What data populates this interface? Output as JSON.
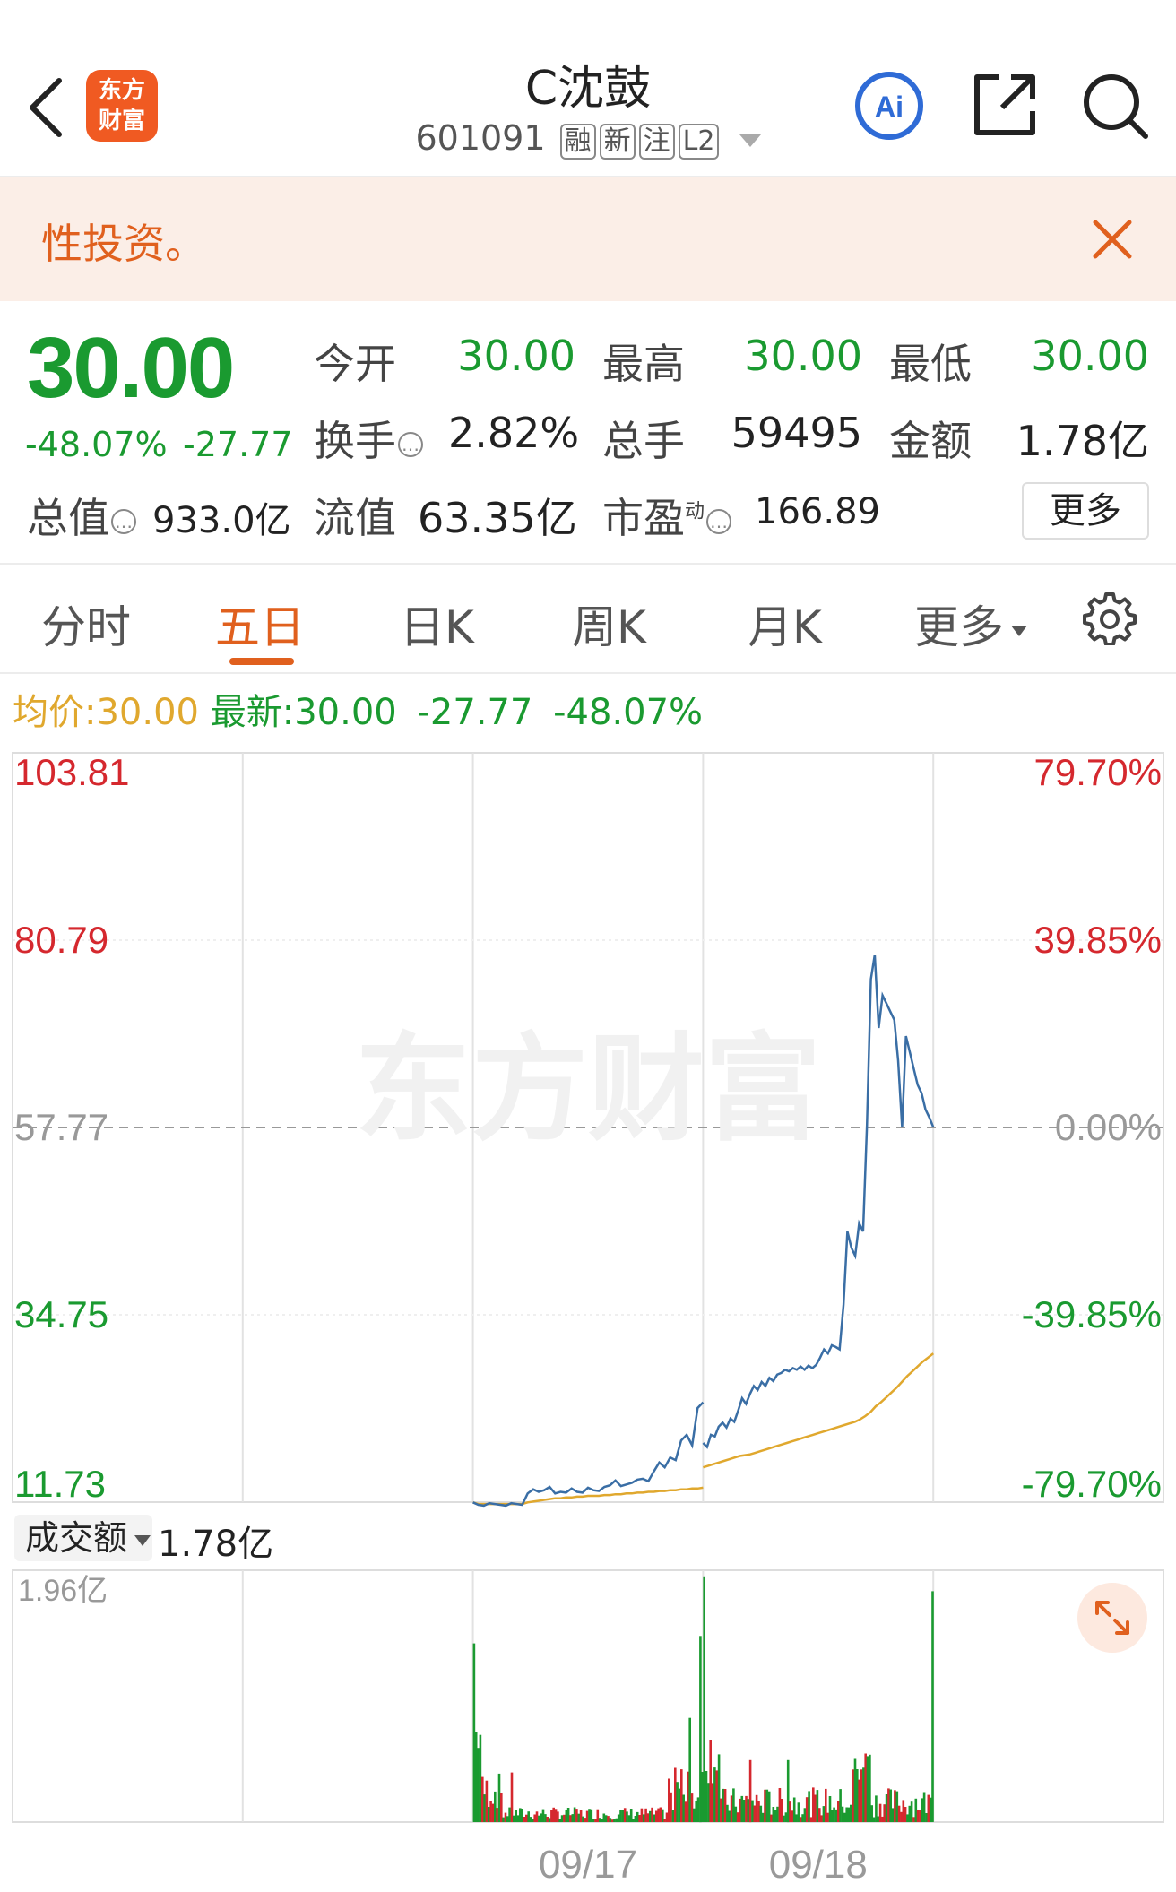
{
  "header": {
    "back_icon": "chevron-left-icon",
    "logo_line1": "东方",
    "logo_line2": "财富",
    "title": "C沈鼓",
    "code": "601091",
    "tags": [
      "融",
      "新",
      "注",
      "L2"
    ],
    "icons": [
      "ai-icon",
      "share-icon",
      "search-icon"
    ],
    "ai_label": "Ai"
  },
  "banner": {
    "text": "性投资。",
    "close_icon": "close-icon"
  },
  "quote": {
    "price": "30.00",
    "change_pct": "-48.07%",
    "change": "-27.77",
    "open_label": "今开",
    "open": "30.00",
    "high_label": "最高",
    "high": "30.00",
    "low_label": "最低",
    "low": "30.00",
    "turnover_label": "换手",
    "turnover": "2.82%",
    "volume_label": "总手",
    "volume": "59495",
    "amount_label": "金额",
    "amount": "1.78亿",
    "mcap_label": "总值",
    "mcap": "933.0亿",
    "float_label": "流值",
    "float_mcap": "63.35亿",
    "pe_label": "市盈",
    "pe_sup": "动",
    "pe": "166.89",
    "more_label": "更多"
  },
  "tabs": {
    "items": [
      "分时",
      "五日",
      "日K",
      "周K",
      "月K",
      "更多"
    ],
    "active": "五日",
    "settings_icon": "gear-icon"
  },
  "summary": {
    "avg_label": "均价:",
    "avg_value": "30.00",
    "latest_label": "最新:",
    "latest_value": "30.00",
    "change": "-27.77",
    "change_pct": "-48.07%"
  },
  "watermark": "东方财富",
  "colors": {
    "up": "#d5282e",
    "down": "#1a9a30",
    "accent": "#e0601e",
    "price_line": "#3a6ea5",
    "avg_line": "#e0a82e"
  },
  "chart_data": {
    "type": "line",
    "y_left_ticks": [
      "103.81",
      "80.79",
      "57.77",
      "34.75",
      "11.73"
    ],
    "y_right_ticks": [
      "79.70%",
      "39.85%",
      "0.00%",
      "-39.85%",
      "-79.70%"
    ],
    "ylim": [
      11.73,
      103.81
    ],
    "reference_price": 57.77,
    "x_labels": [
      "09/17",
      "09/18"
    ],
    "days": 5,
    "series": [
      {
        "day_index": 2,
        "price": [
          11.7,
          11.4,
          11.3,
          11.6,
          11.5,
          11.4,
          11.3,
          11.6,
          11.5,
          11.4,
          12.8,
          13.3,
          13.0,
          13.2,
          13.6,
          12.8,
          13.0,
          12.9,
          13.4,
          13.0,
          12.9,
          13.5,
          13.2,
          13.1,
          13.6,
          13.8,
          14.4,
          13.7,
          13.9,
          14.1,
          14.5,
          14.6,
          14.3,
          15.5,
          16.6,
          16.0,
          17.2,
          16.9,
          19.3,
          20.0,
          18.7,
          23.3,
          24.0
        ],
        "avg": [
          11.7,
          11.5,
          11.5,
          11.5,
          11.5,
          11.5,
          11.5,
          11.5,
          11.5,
          11.5,
          11.7,
          11.8,
          11.9,
          12.0,
          12.1,
          12.2,
          12.2,
          12.3,
          12.3,
          12.4,
          12.4,
          12.5,
          12.5,
          12.5,
          12.6,
          12.6,
          12.7,
          12.7,
          12.8,
          12.8,
          12.9,
          12.9,
          13.0,
          13.0,
          13.1,
          13.1,
          13.2,
          13.2,
          13.3,
          13.3,
          13.4,
          13.4,
          13.5
        ]
      },
      {
        "day_index": 3,
        "price": [
          19.0,
          18.5,
          20.0,
          19.8,
          21.0,
          21.5,
          20.9,
          22.0,
          21.6,
          23.0,
          24.5,
          23.8,
          25.0,
          26.0,
          25.5,
          26.5,
          26.0,
          27.0,
          26.6,
          27.4,
          27.6,
          28.0,
          27.8,
          28.2,
          28.0,
          28.4,
          28.0,
          28.5,
          28.2,
          28.6,
          29.5,
          30.5,
          30.0,
          31.0,
          30.8,
          30.5,
          36.0,
          45.0,
          43.0,
          42.0,
          46.0,
          45.0,
          58.0,
          76.0,
          79.0,
          70.0,
          74.0,
          73.0,
          72.0,
          71.0,
          66.0,
          57.8,
          69.0,
          67.0,
          65.0,
          63.0,
          62.0,
          60.0,
          59.0,
          57.8
        ],
        "avg": [
          16.0,
          16.2,
          16.4,
          16.6,
          16.8,
          17.0,
          17.2,
          17.4,
          17.5,
          17.6,
          17.8,
          18.0,
          18.2,
          18.4,
          18.6,
          18.8,
          19.0,
          19.2,
          19.4,
          19.6,
          19.8,
          20.0,
          20.2,
          20.4,
          20.6,
          20.8,
          21.0,
          21.2,
          21.4,
          21.6,
          21.9,
          22.3,
          22.8,
          23.5,
          24.0,
          24.6,
          25.2,
          25.8,
          26.5,
          27.2,
          27.8,
          28.4,
          29.0,
          29.5,
          30.0
        ]
      }
    ],
    "volume": {
      "max_label": "1.96亿",
      "amount_label": "成交额",
      "amount_value": "1.78亿",
      "max": 1.96
    }
  }
}
